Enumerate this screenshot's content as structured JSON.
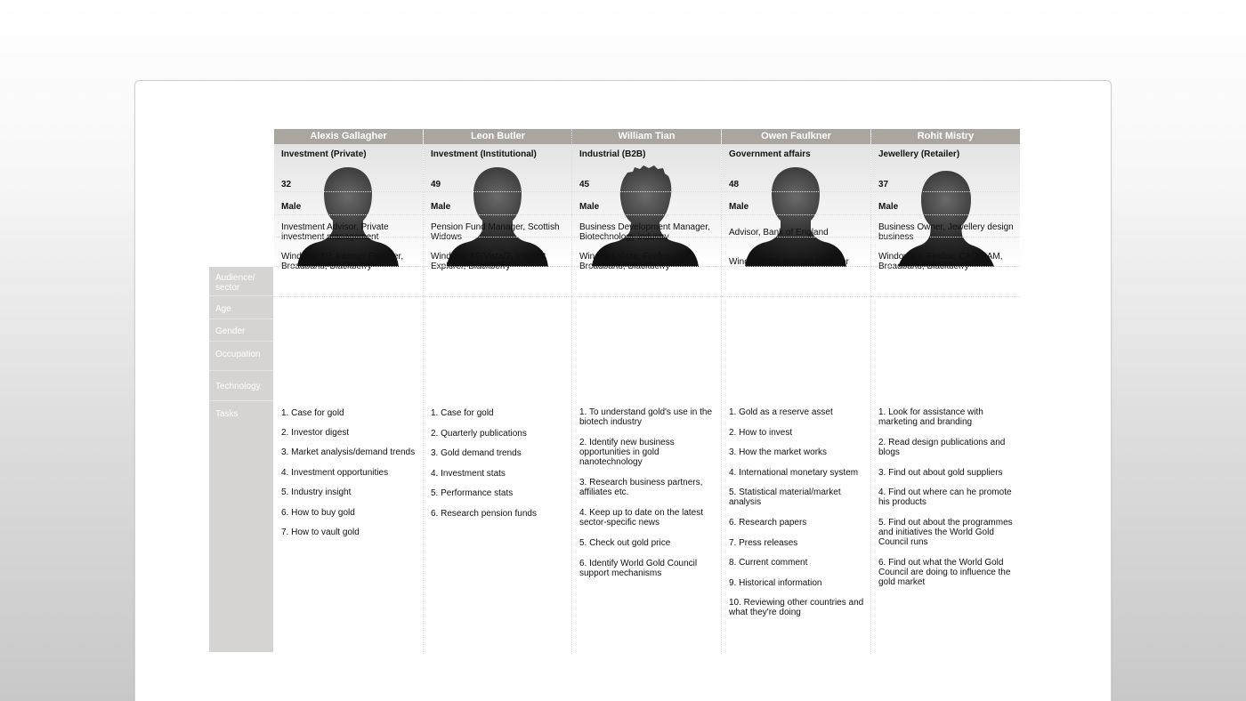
{
  "row_labels": {
    "audience": "Audience/ sector",
    "age": "Age",
    "gender": "Gender",
    "occupation": "Occupation",
    "technology": "Technology",
    "tasks": "Tasks"
  },
  "personas": [
    {
      "name": "Alexis Gallagher",
      "silhouette": "male-silhouette-icon",
      "audience": "Investment (Private)",
      "age": "32",
      "gender": "Male",
      "occupation": "Investment Advisor, Private investment management",
      "technology": "Windows XP, Internet Explorer, Broadband, Blackberry",
      "tasks": [
        "1. Case for gold",
        "2. Investor digest",
        "3. Market analysis/demand trends",
        "4. Investment opportunities",
        "5. Industry insight",
        "6. How to buy gold",
        "7. How to vault gold"
      ]
    },
    {
      "name": "Leon Butler",
      "silhouette": "male-silhouette-icon",
      "audience": "Investment (Institutional)",
      "age": "49",
      "gender": "Male",
      "occupation": "Pension Fund Manager, Scottish Widows",
      "technology": "Windows XP/Vista/7, Internet Explorer, Blackberry",
      "tasks": [
        "1. Case for gold",
        "2. Quarterly publications",
        "3. Gold demand trends",
        "4. Investment stats",
        "5. Performance stats",
        "6. Research pension funds"
      ]
    },
    {
      "name": "William Tian",
      "silhouette": "male-silhouette-icon",
      "audience": "Industrial (B2B)",
      "age": "45",
      "gender": "Male",
      "occupation": "Business Development Manager, Biotechnology industry",
      "technology": "Windows Vista, Firefox, Broadband, Blackberry",
      "tasks": [
        "1. To understand gold's use in the biotech industry",
        "2. Identify new business opportunities in gold nanotechnology",
        "3. Research business partners, affiliates etc.",
        "4. Keep up to date on the latest sector-specific news",
        "5. Check out gold price",
        "6. Identify World Gold Council support mechanisms"
      ]
    },
    {
      "name": "Owen Faulkner",
      "silhouette": "male-silhouette-icon",
      "audience": "Government affairs",
      "age": "48",
      "gender": "Male",
      "occupation": "Advisor, Bank of England",
      "technology": "Windows XP, Internet Explorer",
      "tasks": [
        "1. Gold as a reserve asset",
        "2. How to invest",
        "3. How the market works",
        "4. International monetary system",
        "5. Statistical material/market analysis",
        "6. Research papers",
        "7. Press releases",
        "8. Current comment",
        "9. Historical information",
        "10. Reviewing other countries and what they're doing"
      ]
    },
    {
      "name": "Rohit Mistry",
      "silhouette": "male-silhouette-icon",
      "audience": "Jewellery (Retailer)",
      "age": "37",
      "gender": "Male",
      "occupation": "Business Owner, Jewellery design business",
      "technology": "Windows 7, Firefox, CAD/CAM, Broadband, Blackberry",
      "tasks": [
        "1. Look for assistance with marketing and branding",
        "2. Read design publications and blogs",
        "3. Find out about gold suppliers",
        "4. Find out where can he promote his products",
        "5. Find out about the programmes and initiatives the World Gold Council runs",
        "6. Find out what the World Gold Council are doing to influence the gold market"
      ]
    }
  ]
}
